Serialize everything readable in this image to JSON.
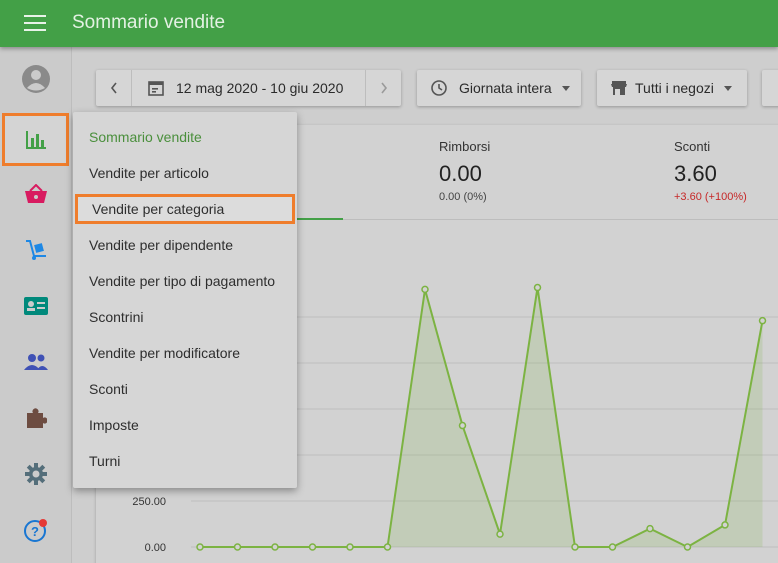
{
  "header": {
    "title": "Sommario vendite",
    "menu_icon": "hamburger-icon"
  },
  "sidebar": {
    "items": [
      {
        "icon": "account-icon"
      },
      {
        "icon": "bar-chart-icon",
        "active": true
      },
      {
        "icon": "basket-icon"
      },
      {
        "icon": "cart-dolly-icon"
      },
      {
        "icon": "contact-card-icon"
      },
      {
        "icon": "people-icon"
      },
      {
        "icon": "puzzle-icon"
      },
      {
        "icon": "gear-icon"
      },
      {
        "icon": "help-icon"
      }
    ]
  },
  "toolbar": {
    "date_range": "12 mag 2020 - 10 giu 2020",
    "day_filter": "Giornata intera",
    "store_filter": "Tutti i negozi"
  },
  "kpis": [
    {
      "label": "Rimborsi",
      "value": "0.00",
      "sub": "0.00 (0%)"
    },
    {
      "label": "Sconti",
      "value": "3.60",
      "sub": "+3.60 (+100%)"
    }
  ],
  "menu": {
    "items": [
      "Sommario vendite",
      "Vendite per articolo",
      "Vendite per categoria",
      "Vendite per dipendente",
      "Vendite per tipo di pagamento",
      "Scontrini",
      "Vendite per modificatore",
      "Sconti",
      "Imposte",
      "Turni"
    ],
    "selected_index": 0,
    "highlight_index": 2
  },
  "colors": {
    "brand": "#43a047",
    "highlight": "#ef7d2c",
    "negative": "#c62828"
  },
  "chart_data": {
    "type": "area",
    "y_tick_labels": [
      "250.00",
      "0.00"
    ],
    "ylim": [
      0,
      1650
    ],
    "x_index": [
      0,
      1,
      2,
      3,
      4,
      5,
      6,
      7,
      8,
      9,
      10,
      11,
      12,
      13,
      14,
      15
    ],
    "values": [
      0,
      0,
      0,
      0,
      0,
      0,
      1400,
      660,
      70,
      1410,
      0,
      0,
      100,
      0,
      120,
      1230
    ]
  }
}
